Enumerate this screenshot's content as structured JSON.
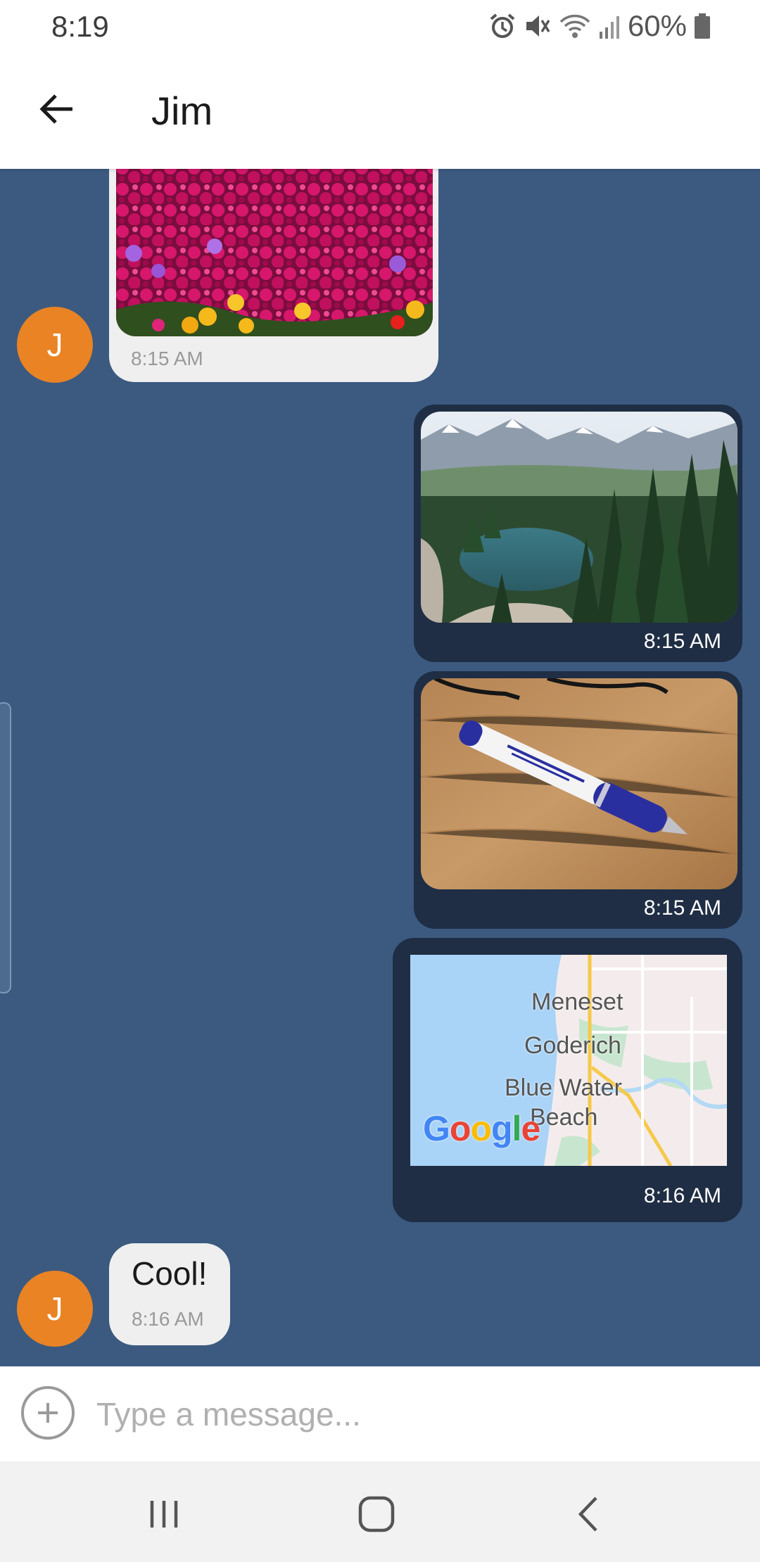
{
  "status": {
    "time": "8:19",
    "battery": "60%"
  },
  "header": {
    "title": "Jim"
  },
  "contact": {
    "initial": "J",
    "avatar_color": "#e98324"
  },
  "messages": [
    {
      "type": "image",
      "direction": "incoming",
      "image": "pink flower field",
      "time": "8:15 AM"
    },
    {
      "type": "image",
      "direction": "outgoing",
      "image": "mountain lake and forest",
      "time": "8:15 AM"
    },
    {
      "type": "image",
      "direction": "outgoing",
      "image": "pen on wooden desk",
      "time": "8:15 AM"
    },
    {
      "type": "location",
      "direction": "outgoing",
      "map_places": [
        "Meneset",
        "Goderich",
        "Blue Water",
        "Beach"
      ],
      "map_brand": "Google",
      "time": "8:16 AM"
    },
    {
      "type": "text",
      "direction": "incoming",
      "text": "Cool!",
      "time": "8:16 AM"
    }
  ],
  "composer": {
    "placeholder": "Type a message..."
  },
  "colors": {
    "chat_background": "#3c5a80",
    "outgoing_bubble": "#1f2e44",
    "incoming_bubble": "#efefef"
  },
  "icons": [
    "alarm-icon",
    "mute-icon",
    "wifi-icon",
    "signal-icon",
    "battery-icon",
    "back-arrow-icon",
    "add-icon",
    "recent-apps-icon",
    "home-icon",
    "nav-back-icon"
  ]
}
